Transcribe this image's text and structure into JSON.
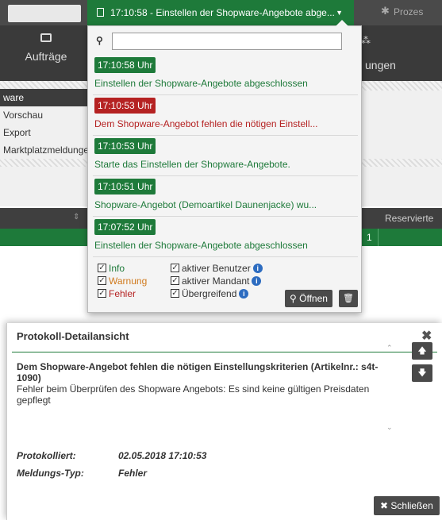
{
  "topbar": {
    "protocol_selected": "17:10:58 - Einstellen der Shopware-Angebote abge...",
    "prozess_label": "Prozes"
  },
  "nav": {
    "auftraege": "Aufträge",
    "settings_partial": "ungen"
  },
  "sidemenu": {
    "items": [
      "ware",
      "Vorschau",
      "Export",
      "Marktplatzmeldungen"
    ]
  },
  "table": {
    "reserved_header": "Reservierte",
    "row_count": "1"
  },
  "panel": {
    "search": {
      "value": "",
      "placeholder": ""
    },
    "entries": [
      {
        "time": "17:10:58 Uhr",
        "message": "Einstellen der Shopware-Angebote abgeschlossen",
        "level": "info"
      },
      {
        "time": "17:10:53 Uhr",
        "message": "Dem Shopware-Angebot fehlen die nötigen Einstell...",
        "level": "error"
      },
      {
        "time": "17:10:53 Uhr",
        "message": "Starte das Einstellen der Shopware-Angebote.",
        "level": "info"
      },
      {
        "time": "17:10:51 Uhr",
        "message": "Shopware-Angebot (Demoartikel Daunenjacke) wu...",
        "level": "info"
      },
      {
        "time": "17:07:52 Uhr",
        "message": "Einstellen der Shopware-Angebote abgeschlossen",
        "level": "info"
      }
    ],
    "filters": {
      "info": "Info",
      "warnung": "Warnung",
      "fehler": "Fehler",
      "aktiver_benutzer": "aktiver Benutzer",
      "aktiver_mandant": "aktiver Mandant",
      "uebergreifend": "Übergreifend"
    },
    "open_button": "Öffnen"
  },
  "modal": {
    "title": "Protokoll-Detailansicht",
    "detail_heading": "Dem Shopware-Angebot fehlen die nötigen Einstellungskriterien (Artikelnr.: s4t-1090)",
    "detail_body": "Fehler beim Überprüfen des Shopware Angebots: Es sind keine gültigen Preisdaten gepflegt",
    "protokolliert_label": "Protokolliert:",
    "protokolliert_value": "02.05.2018 17:10:53",
    "meldungstyp_label": "Meldungs-Typ:",
    "meldungstyp_value": "Fehler",
    "close_button": "Schließen"
  },
  "colors": {
    "green": "#1e7a3a",
    "red": "#b52222",
    "orange": "#d07a1e",
    "dark": "#4a4a4a",
    "info_blue": "#2d6cc0"
  }
}
